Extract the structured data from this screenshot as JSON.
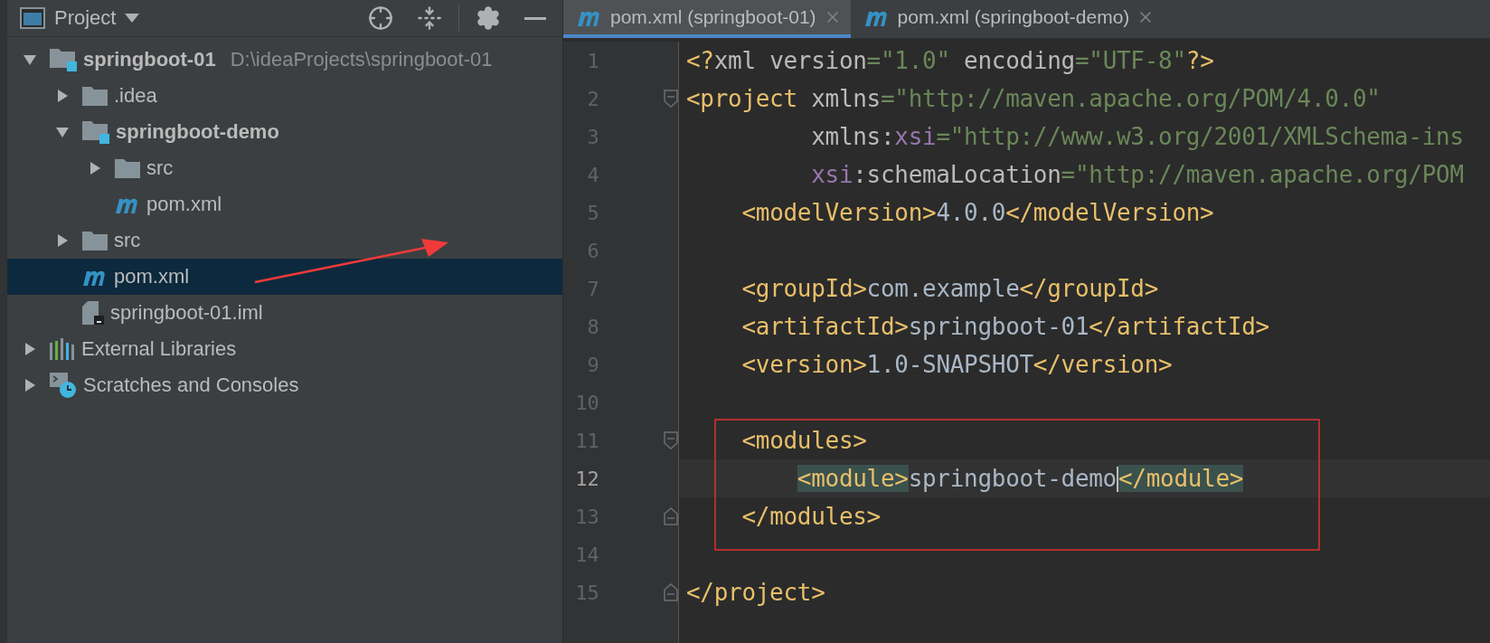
{
  "project_panel": {
    "title": "Project",
    "tree": [
      {
        "label": "springboot-01",
        "hint": "D:\\ideaProjects\\springboot-01",
        "kind": "module",
        "bold": true,
        "expanded": true,
        "selected": false,
        "children": [
          {
            "label": ".idea",
            "kind": "folder",
            "bold": false,
            "expanded": false,
            "selected": false
          },
          {
            "label": "springboot-demo",
            "kind": "module",
            "bold": true,
            "expanded": true,
            "selected": false,
            "children": [
              {
                "label": "src",
                "kind": "folder",
                "bold": false,
                "expanded": false,
                "selected": false
              },
              {
                "label": "pom.xml",
                "kind": "maven",
                "bold": false,
                "selected": false
              }
            ]
          },
          {
            "label": "src",
            "kind": "folder",
            "bold": false,
            "expanded": false,
            "selected": false
          },
          {
            "label": "pom.xml",
            "kind": "maven",
            "bold": false,
            "selected": true
          },
          {
            "label": "springboot-01.iml",
            "kind": "iml",
            "bold": false,
            "selected": false
          }
        ]
      },
      {
        "label": "External Libraries",
        "kind": "libraries",
        "bold": false,
        "expanded": false,
        "selected": false
      },
      {
        "label": "Scratches and Consoles",
        "kind": "scratches",
        "bold": false,
        "expanded": false,
        "selected": false
      }
    ]
  },
  "editor": {
    "tabs": [
      {
        "label": "pom.xml (springboot-01)",
        "selected": true
      },
      {
        "label": "pom.xml (springboot-demo)",
        "selected": false
      }
    ],
    "lines": [
      {
        "number": "1",
        "fold_start": false,
        "fold_end": false,
        "current": false,
        "tokens": [
          {
            "kind": "tag",
            "text": "<?"
          },
          {
            "kind": "attr",
            "text": "xml version"
          },
          {
            "kind": "eq",
            "text": "="
          },
          {
            "kind": "str",
            "text": "\"1.0\""
          },
          {
            "kind": "attr",
            "text": " encoding"
          },
          {
            "kind": "eq",
            "text": "="
          },
          {
            "kind": "str",
            "text": "\"UTF-8\""
          },
          {
            "kind": "tag",
            "text": "?>"
          }
        ]
      },
      {
        "number": "2",
        "fold_start": true,
        "fold_end": false,
        "current": false,
        "tokens": [
          {
            "kind": "tag",
            "text": "<project"
          },
          {
            "kind": "attr",
            "text": " xmlns"
          },
          {
            "kind": "eq",
            "text": "="
          },
          {
            "kind": "str",
            "text": "\"http://maven.apache.org/POM/4.0.0\""
          }
        ]
      },
      {
        "number": "3",
        "fold_start": false,
        "fold_end": false,
        "current": false,
        "tokens": [
          {
            "kind": "attr",
            "text": "         xmlns:"
          },
          {
            "kind": "ns",
            "text": "xsi"
          },
          {
            "kind": "eq",
            "text": "="
          },
          {
            "kind": "str",
            "text": "\"http://www.w3.org/2001/XMLSchema-ins"
          }
        ]
      },
      {
        "number": "4",
        "fold_start": false,
        "fold_end": false,
        "current": false,
        "tokens": [
          {
            "kind": "ns",
            "text": "         xsi"
          },
          {
            "kind": "attr",
            "text": ":schemaLocation"
          },
          {
            "kind": "eq",
            "text": "="
          },
          {
            "kind": "str",
            "text": "\"http://maven.apache.org/POM"
          }
        ]
      },
      {
        "number": "5",
        "fold_start": false,
        "fold_end": false,
        "current": false,
        "tokens": [
          {
            "kind": "tag",
            "text": "    <modelVersion>"
          },
          {
            "kind": "text",
            "text": "4.0.0"
          },
          {
            "kind": "tag",
            "text": "</modelVersion>"
          }
        ]
      },
      {
        "number": "6",
        "fold_start": false,
        "fold_end": false,
        "current": false
      },
      {
        "number": "7",
        "fold_start": false,
        "fold_end": false,
        "current": false,
        "tokens": [
          {
            "kind": "tag",
            "text": "    <groupId>"
          },
          {
            "kind": "text",
            "text": "com.example"
          },
          {
            "kind": "tag",
            "text": "</groupId>"
          }
        ]
      },
      {
        "number": "8",
        "fold_start": false,
        "fold_end": false,
        "current": false,
        "tokens": [
          {
            "kind": "tag",
            "text": "    <artifactId>"
          },
          {
            "kind": "text",
            "text": "springboot-01"
          },
          {
            "kind": "tag",
            "text": "</artifactId>"
          }
        ]
      },
      {
        "number": "9",
        "fold_start": false,
        "fold_end": false,
        "current": false,
        "tokens": [
          {
            "kind": "tag",
            "text": "    <version>"
          },
          {
            "kind": "text",
            "text": "1.0-SNAPSHOT"
          },
          {
            "kind": "tag",
            "text": "</version>"
          }
        ]
      },
      {
        "number": "10",
        "fold_start": false,
        "fold_end": false,
        "current": false
      },
      {
        "number": "11",
        "fold_start": true,
        "fold_end": false,
        "current": false,
        "tokens": [
          {
            "kind": "tag",
            "text": "    <modules>"
          }
        ]
      },
      {
        "number": "12",
        "fold_start": false,
        "fold_end": false,
        "current": true,
        "tokens": [
          {
            "kind": "tag",
            "text": "        <module>",
            "matched": true,
            "caret": false
          },
          {
            "kind": "text",
            "text": "springboot-demo",
            "matched": false,
            "caret": true
          },
          {
            "kind": "tag",
            "text": "</module>",
            "matched": true,
            "caret": false
          }
        ]
      },
      {
        "number": "13",
        "fold_start": false,
        "fold_end": true,
        "current": false,
        "tokens": [
          {
            "kind": "tag",
            "text": "    </modules>"
          }
        ]
      },
      {
        "number": "14",
        "fold_start": false,
        "fold_end": false,
        "current": false
      },
      {
        "number": "15",
        "fold_start": false,
        "fold_end": true,
        "current": false,
        "tokens": [
          {
            "kind": "tag",
            "text": "</project>"
          }
        ]
      }
    ]
  }
}
